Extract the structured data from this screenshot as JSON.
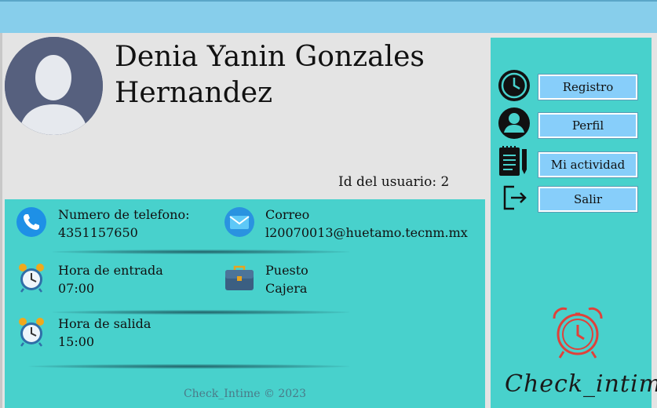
{
  "user": {
    "name": "Denia Yanin Gonzales Hernandez",
    "id_label": "Id del usuario:",
    "id_value": "2"
  },
  "info": {
    "phone": {
      "label": "Numero de telefono:",
      "value": "4351157650",
      "icon": "phone-icon"
    },
    "email": {
      "label": "Correo",
      "value": "l20070013@huetamo.tecnm.mx",
      "icon": "mail-icon"
    },
    "entry": {
      "label": "Hora de entrada",
      "value": "07:00",
      "icon": "alarm-clock-icon"
    },
    "position": {
      "label": "Puesto",
      "value": "Cajera",
      "icon": "briefcase-icon"
    },
    "exit": {
      "label": "Hora de salida",
      "value": "15:00",
      "icon": "alarm-clock-icon"
    }
  },
  "footer": {
    "copyright": "Check_Intime © 2023"
  },
  "nav": {
    "items": [
      {
        "label": "Registro",
        "icon": "clock-icon"
      },
      {
        "label": "Perfil",
        "icon": "user-icon"
      },
      {
        "label": "Mi actividad",
        "icon": "notepad-icon"
      },
      {
        "label": "Salir",
        "icon": "logout-icon"
      }
    ]
  },
  "brand": {
    "name": "Check_intime"
  },
  "colors": {
    "topbar": "#87ceeb",
    "panel": "#48d1cc",
    "button": "#87cefa",
    "background": "#e4e4e4"
  }
}
